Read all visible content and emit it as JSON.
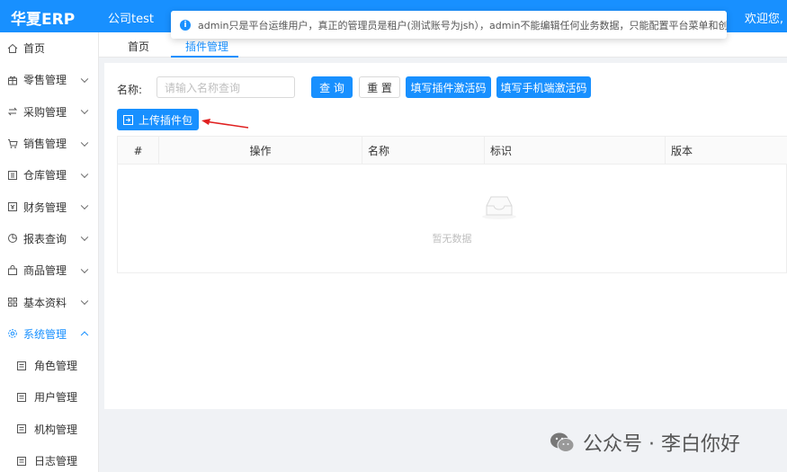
{
  "header": {
    "logo": "华夏ERP",
    "company": "公司test",
    "welcome": "欢迎您,"
  },
  "notice": {
    "text": "admin只是平台运维用户，真正的管理员是租户(测试账号为jsh），admin不能编辑任何业务数据，只能配置平台菜单和创建租户"
  },
  "sidebar": {
    "items": [
      {
        "label": "首页",
        "icon": "home-icon"
      },
      {
        "label": "零售管理",
        "icon": "gift-icon"
      },
      {
        "label": "采购管理",
        "icon": "swap-icon"
      },
      {
        "label": "销售管理",
        "icon": "cart-icon"
      },
      {
        "label": "仓库管理",
        "icon": "warehouse-icon"
      },
      {
        "label": "财务管理",
        "icon": "finance-icon"
      },
      {
        "label": "报表查询",
        "icon": "pie-chart-icon"
      },
      {
        "label": "商品管理",
        "icon": "shop-icon"
      },
      {
        "label": "基本资料",
        "icon": "grid-icon"
      },
      {
        "label": "系统管理",
        "icon": "settings-icon"
      }
    ],
    "subitems": [
      {
        "label": "角色管理",
        "icon": "doc-icon"
      },
      {
        "label": "用户管理",
        "icon": "doc-icon"
      },
      {
        "label": "机构管理",
        "icon": "doc-icon"
      },
      {
        "label": "日志管理",
        "icon": "doc-icon"
      }
    ]
  },
  "tabs": [
    {
      "label": "首页"
    },
    {
      "label": "插件管理"
    }
  ],
  "search": {
    "label": "名称:",
    "placeholder": "请输入名称查询",
    "query_btn": "查 询",
    "reset_btn": "重 置",
    "plugin_code_btn": "填写插件激活码",
    "mobile_code_btn": "填写手机端激活码",
    "upload_btn": "上传插件包"
  },
  "table": {
    "columns": [
      "#",
      "操作",
      "名称",
      "标识",
      "版本"
    ],
    "empty_text": "暂无数据"
  },
  "watermark": {
    "text": "公众号 · 李白你好"
  },
  "colors": {
    "primary": "#1890ff",
    "arrow": "#e02020"
  }
}
